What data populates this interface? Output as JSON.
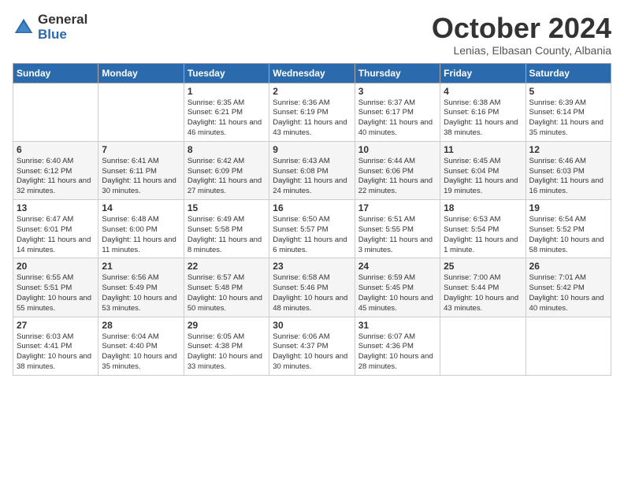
{
  "logo": {
    "general": "General",
    "blue": "Blue"
  },
  "header": {
    "month": "October 2024",
    "location": "Lenias, Elbasan County, Albania"
  },
  "days_of_week": [
    "Sunday",
    "Monday",
    "Tuesday",
    "Wednesday",
    "Thursday",
    "Friday",
    "Saturday"
  ],
  "weeks": [
    [
      {
        "day": "",
        "content": ""
      },
      {
        "day": "",
        "content": ""
      },
      {
        "day": "1",
        "content": "Sunrise: 6:35 AM\nSunset: 6:21 PM\nDaylight: 11 hours and 46 minutes."
      },
      {
        "day": "2",
        "content": "Sunrise: 6:36 AM\nSunset: 6:19 PM\nDaylight: 11 hours and 43 minutes."
      },
      {
        "day": "3",
        "content": "Sunrise: 6:37 AM\nSunset: 6:17 PM\nDaylight: 11 hours and 40 minutes."
      },
      {
        "day": "4",
        "content": "Sunrise: 6:38 AM\nSunset: 6:16 PM\nDaylight: 11 hours and 38 minutes."
      },
      {
        "day": "5",
        "content": "Sunrise: 6:39 AM\nSunset: 6:14 PM\nDaylight: 11 hours and 35 minutes."
      }
    ],
    [
      {
        "day": "6",
        "content": "Sunrise: 6:40 AM\nSunset: 6:12 PM\nDaylight: 11 hours and 32 minutes."
      },
      {
        "day": "7",
        "content": "Sunrise: 6:41 AM\nSunset: 6:11 PM\nDaylight: 11 hours and 30 minutes."
      },
      {
        "day": "8",
        "content": "Sunrise: 6:42 AM\nSunset: 6:09 PM\nDaylight: 11 hours and 27 minutes."
      },
      {
        "day": "9",
        "content": "Sunrise: 6:43 AM\nSunset: 6:08 PM\nDaylight: 11 hours and 24 minutes."
      },
      {
        "day": "10",
        "content": "Sunrise: 6:44 AM\nSunset: 6:06 PM\nDaylight: 11 hours and 22 minutes."
      },
      {
        "day": "11",
        "content": "Sunrise: 6:45 AM\nSunset: 6:04 PM\nDaylight: 11 hours and 19 minutes."
      },
      {
        "day": "12",
        "content": "Sunrise: 6:46 AM\nSunset: 6:03 PM\nDaylight: 11 hours and 16 minutes."
      }
    ],
    [
      {
        "day": "13",
        "content": "Sunrise: 6:47 AM\nSunset: 6:01 PM\nDaylight: 11 hours and 14 minutes."
      },
      {
        "day": "14",
        "content": "Sunrise: 6:48 AM\nSunset: 6:00 PM\nDaylight: 11 hours and 11 minutes."
      },
      {
        "day": "15",
        "content": "Sunrise: 6:49 AM\nSunset: 5:58 PM\nDaylight: 11 hours and 8 minutes."
      },
      {
        "day": "16",
        "content": "Sunrise: 6:50 AM\nSunset: 5:57 PM\nDaylight: 11 hours and 6 minutes."
      },
      {
        "day": "17",
        "content": "Sunrise: 6:51 AM\nSunset: 5:55 PM\nDaylight: 11 hours and 3 minutes."
      },
      {
        "day": "18",
        "content": "Sunrise: 6:53 AM\nSunset: 5:54 PM\nDaylight: 11 hours and 1 minute."
      },
      {
        "day": "19",
        "content": "Sunrise: 6:54 AM\nSunset: 5:52 PM\nDaylight: 10 hours and 58 minutes."
      }
    ],
    [
      {
        "day": "20",
        "content": "Sunrise: 6:55 AM\nSunset: 5:51 PM\nDaylight: 10 hours and 55 minutes."
      },
      {
        "day": "21",
        "content": "Sunrise: 6:56 AM\nSunset: 5:49 PM\nDaylight: 10 hours and 53 minutes."
      },
      {
        "day": "22",
        "content": "Sunrise: 6:57 AM\nSunset: 5:48 PM\nDaylight: 10 hours and 50 minutes."
      },
      {
        "day": "23",
        "content": "Sunrise: 6:58 AM\nSunset: 5:46 PM\nDaylight: 10 hours and 48 minutes."
      },
      {
        "day": "24",
        "content": "Sunrise: 6:59 AM\nSunset: 5:45 PM\nDaylight: 10 hours and 45 minutes."
      },
      {
        "day": "25",
        "content": "Sunrise: 7:00 AM\nSunset: 5:44 PM\nDaylight: 10 hours and 43 minutes."
      },
      {
        "day": "26",
        "content": "Sunrise: 7:01 AM\nSunset: 5:42 PM\nDaylight: 10 hours and 40 minutes."
      }
    ],
    [
      {
        "day": "27",
        "content": "Sunrise: 6:03 AM\nSunset: 4:41 PM\nDaylight: 10 hours and 38 minutes."
      },
      {
        "day": "28",
        "content": "Sunrise: 6:04 AM\nSunset: 4:40 PM\nDaylight: 10 hours and 35 minutes."
      },
      {
        "day": "29",
        "content": "Sunrise: 6:05 AM\nSunset: 4:38 PM\nDaylight: 10 hours and 33 minutes."
      },
      {
        "day": "30",
        "content": "Sunrise: 6:06 AM\nSunset: 4:37 PM\nDaylight: 10 hours and 30 minutes."
      },
      {
        "day": "31",
        "content": "Sunrise: 6:07 AM\nSunset: 4:36 PM\nDaylight: 10 hours and 28 minutes."
      },
      {
        "day": "",
        "content": ""
      },
      {
        "day": "",
        "content": ""
      }
    ]
  ]
}
